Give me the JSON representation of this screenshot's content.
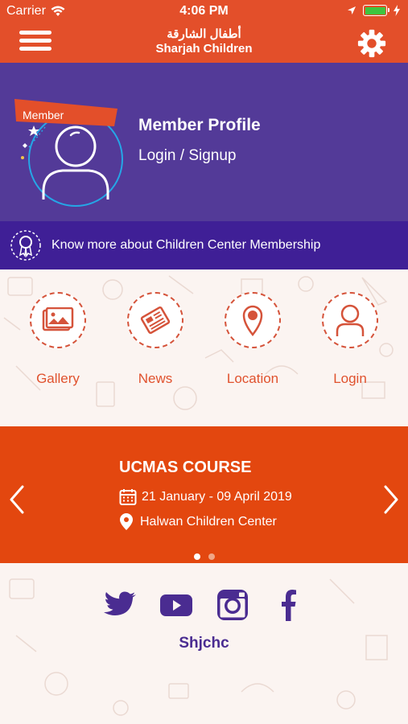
{
  "status_bar": {
    "carrier": "Carrier",
    "time": "4:06 PM"
  },
  "header": {
    "title_ar": "أطفال الشارقة",
    "title_en": "Sharjah Children",
    "menu_icon": "hamburger-menu-icon",
    "settings_icon": "gear-icon"
  },
  "profile": {
    "badge": "Member",
    "title": "Member Profile",
    "login_link": "Login / Signup"
  },
  "membership": {
    "text": "Know more about Children Center Membership",
    "icon": "ribbon-badge-icon"
  },
  "quick_links": [
    {
      "label": "Gallery",
      "icon": "gallery-icon"
    },
    {
      "label": "News",
      "icon": "newspaper-icon"
    },
    {
      "label": "Location",
      "icon": "map-pin-icon"
    },
    {
      "label": "Login",
      "icon": "user-icon"
    }
  ],
  "event": {
    "title": "UCMAS COURSE",
    "date": "21 January - 09 April 2019",
    "location": "Halwan Children Center",
    "page_count": 2,
    "active_page": 1
  },
  "social": {
    "handle": "Shjchc",
    "icons": [
      "twitter-icon",
      "youtube-icon",
      "instagram-icon",
      "facebook-icon"
    ]
  },
  "colors": {
    "brand": "#e34f2a",
    "profile_bg": "#533a98",
    "strip_bg": "#3f1f96",
    "event_bg": "#e3470f",
    "accent_blue": "#25a6e6",
    "text_purple": "#4a2c91"
  }
}
